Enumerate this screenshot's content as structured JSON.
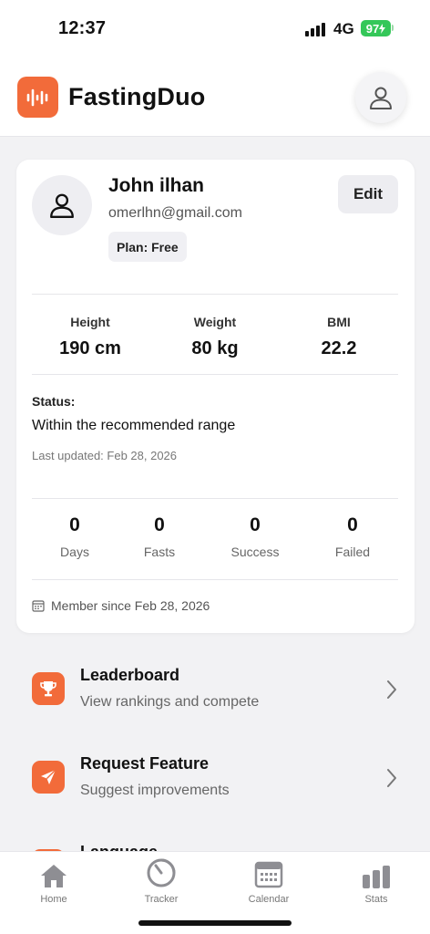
{
  "status_bar": {
    "time": "12:37",
    "network": "4G",
    "battery": "97"
  },
  "header": {
    "app_name": "FastingDuo"
  },
  "profile": {
    "name": "John ilhan",
    "email": "omerlhn@gmail.com",
    "plan": "Plan: Free",
    "edit_label": "Edit"
  },
  "metrics": [
    {
      "label": "Height",
      "value": "190 cm"
    },
    {
      "label": "Weight",
      "value": "80 kg"
    },
    {
      "label": "BMI",
      "value": "22.2"
    }
  ],
  "status": {
    "label": "Status:",
    "text": "Within the recommended range",
    "updated": "Last updated: Feb 28, 2026"
  },
  "stats": [
    {
      "value": "0",
      "label": "Days"
    },
    {
      "value": "0",
      "label": "Fasts"
    },
    {
      "value": "0",
      "label": "Success"
    },
    {
      "value": "0",
      "label": "Failed"
    }
  ],
  "member_since": "Member since Feb 28, 2026",
  "menu": [
    {
      "title": "Leaderboard",
      "subtitle": "View rankings and compete",
      "icon": "trophy-icon"
    },
    {
      "title": "Request Feature",
      "subtitle": "Suggest improvements",
      "icon": "send-icon"
    },
    {
      "title": "Language",
      "icon": "globe-icon"
    }
  ],
  "tabs": [
    {
      "label": "Home",
      "icon": "home-icon"
    },
    {
      "label": "Tracker",
      "icon": "timer-icon"
    },
    {
      "label": "Calendar",
      "icon": "calendar-icon"
    },
    {
      "label": "Stats",
      "icon": "bar-chart-icon"
    }
  ],
  "colors": {
    "accent": "#f26b3a",
    "battery": "#34c759",
    "tab_icon": "#8e8e93"
  }
}
